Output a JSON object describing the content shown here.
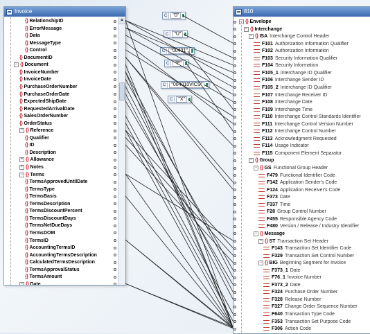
{
  "invoice_panel": {
    "title": "Invoice",
    "rows": [
      {
        "label": "RelationshipID",
        "level": 3,
        "kind": "elem"
      },
      {
        "label": "ErrorMessage",
        "level": 3,
        "kind": "elem"
      },
      {
        "label": "Data",
        "level": 3,
        "kind": "elem"
      },
      {
        "label": "MessageType",
        "level": 3,
        "kind": "elem"
      },
      {
        "label": "Control",
        "level": 3,
        "kind": "elem"
      },
      {
        "label": "DocumentID",
        "level": 2,
        "kind": "elem"
      },
      {
        "label": "Document",
        "level": 1,
        "kind": "group",
        "toggle": "−"
      },
      {
        "label": "InvoiceNumber",
        "level": 2,
        "kind": "elem"
      },
      {
        "label": "InvoiceDate",
        "level": 2,
        "kind": "elem"
      },
      {
        "label": "PurchaseOrderNumber",
        "level": 2,
        "kind": "elem"
      },
      {
        "label": "PurchaseOrderDate",
        "level": 2,
        "kind": "elem"
      },
      {
        "label": "ExpectedShipDate",
        "level": 2,
        "kind": "elem"
      },
      {
        "label": "RequestedArrivalDate",
        "level": 2,
        "kind": "elem"
      },
      {
        "label": "SalesOrderNumber",
        "level": 2,
        "kind": "elem"
      },
      {
        "label": "OrderStatus",
        "level": 2,
        "kind": "elem"
      },
      {
        "label": "Reference",
        "level": 2,
        "kind": "group",
        "toggle": "−"
      },
      {
        "label": "Qualifier",
        "level": 3,
        "kind": "elem"
      },
      {
        "label": "ID",
        "level": 3,
        "kind": "elem"
      },
      {
        "label": "Description",
        "level": 3,
        "kind": "elem"
      },
      {
        "label": "Allowance",
        "level": 2,
        "kind": "group",
        "toggle": "+"
      },
      {
        "label": "Notes",
        "level": 2,
        "kind": "group",
        "toggle": "+"
      },
      {
        "label": "Terms",
        "level": 2,
        "kind": "group",
        "toggle": "−"
      },
      {
        "label": "TermsApprovedUntilDate",
        "level": 3,
        "kind": "elem"
      },
      {
        "label": "TermsType",
        "level": 3,
        "kind": "elem"
      },
      {
        "label": "TermsBasis",
        "level": 3,
        "kind": "elem"
      },
      {
        "label": "TermsDescription",
        "level": 3,
        "kind": "elem"
      },
      {
        "label": "TermsDiscountPercent",
        "level": 3,
        "kind": "elem"
      },
      {
        "label": "TermsDiscountDays",
        "level": 3,
        "kind": "elem"
      },
      {
        "label": "TermsNetDueDays",
        "level": 3,
        "kind": "elem"
      },
      {
        "label": "TermsDOM",
        "level": 3,
        "kind": "elem"
      },
      {
        "label": "TermsID",
        "level": 3,
        "kind": "elem"
      },
      {
        "label": "AccountingTermsID",
        "level": 3,
        "kind": "elem"
      },
      {
        "label": "AccountingTermsDescription",
        "level": 3,
        "kind": "elem"
      },
      {
        "label": "CalculatedTermsDescription",
        "level": 3,
        "kind": "elem"
      },
      {
        "label": "TermsApprovalStatus",
        "level": 3,
        "kind": "elem"
      },
      {
        "label": "TermsAmount",
        "level": 3,
        "kind": "elem"
      },
      {
        "label": "Date",
        "level": 2,
        "kind": "group",
        "toggle": "−"
      }
    ]
  },
  "edi_panel": {
    "title": "810",
    "rows": [
      {
        "label": "Envelope",
        "level": 0,
        "kind": "group",
        "toggle": "−"
      },
      {
        "label": "Interchange",
        "level": 1,
        "kind": "group",
        "toggle": "−"
      },
      {
        "label": "ISA",
        "desc": "Interchange Control Header",
        "level": 2,
        "kind": "group",
        "toggle": "−"
      },
      {
        "label": "F101",
        "desc": "Authorization Information Qualifier",
        "level": 3,
        "kind": "attr"
      },
      {
        "label": "F102",
        "desc": "Authorization Information",
        "level": 3,
        "kind": "attr"
      },
      {
        "label": "F103",
        "desc": "Security Information Qualifier",
        "level": 3,
        "kind": "attr"
      },
      {
        "label": "F104",
        "desc": "Security Information",
        "level": 3,
        "kind": "attr"
      },
      {
        "label": "F105_1",
        "desc": "Interchange ID Qualifier",
        "level": 3,
        "kind": "attr"
      },
      {
        "label": "F106",
        "desc": "Interchange Sender ID",
        "level": 3,
        "kind": "attr"
      },
      {
        "label": "F105_2",
        "desc": "Interchange ID Qualifier",
        "level": 3,
        "kind": "attr"
      },
      {
        "label": "F107",
        "desc": "Interchange Receiver ID",
        "level": 3,
        "kind": "attr"
      },
      {
        "label": "F108",
        "desc": "Interchange Date",
        "level": 3,
        "kind": "attr"
      },
      {
        "label": "F109",
        "desc": "Interchange Time",
        "level": 3,
        "kind": "attr"
      },
      {
        "label": "F110",
        "desc": "Interchange Control Standards Identifier",
        "level": 3,
        "kind": "attr"
      },
      {
        "label": "F111",
        "desc": "Interchange Control Version Number",
        "level": 3,
        "kind": "attr"
      },
      {
        "label": "F112",
        "desc": "Interchange Control Number",
        "level": 3,
        "kind": "attr"
      },
      {
        "label": "F113",
        "desc": "Acknowledgment Requested",
        "level": 3,
        "kind": "attr"
      },
      {
        "label": "F114",
        "desc": "Usage Indicator",
        "level": 3,
        "kind": "attr"
      },
      {
        "label": "F115",
        "desc": "Component Element Separator",
        "level": 3,
        "kind": "attr"
      },
      {
        "label": "Group",
        "level": 2,
        "kind": "group",
        "toggle": "−"
      },
      {
        "label": "GS",
        "desc": "Functional Group Header",
        "level": 3,
        "kind": "group",
        "toggle": "−"
      },
      {
        "label": "F479",
        "desc": "Functional Identifier Code",
        "level": 4,
        "kind": "attr"
      },
      {
        "label": "F142",
        "desc": "Application Sender's Code",
        "level": 4,
        "kind": "attr"
      },
      {
        "label": "F124",
        "desc": "Application Receiver's Code",
        "level": 4,
        "kind": "attr"
      },
      {
        "label": "F373",
        "desc": "Date",
        "level": 4,
        "kind": "attr"
      },
      {
        "label": "F337",
        "desc": "Time",
        "level": 4,
        "kind": "attr"
      },
      {
        "label": "F28",
        "desc": "Group Control Number",
        "level": 4,
        "kind": "attr"
      },
      {
        "label": "F455",
        "desc": "Responsible Agency Code",
        "level": 4,
        "kind": "attr"
      },
      {
        "label": "F480",
        "desc": "Version / Release / Industry Identifier",
        "level": 4,
        "kind": "attr"
      },
      {
        "label": "Message",
        "level": 3,
        "kind": "group",
        "toggle": "−"
      },
      {
        "label": "ST",
        "desc": "Transaction Set Header",
        "level": 4,
        "kind": "group",
        "toggle": "−"
      },
      {
        "label": "F143",
        "desc": "Transaction Set Identifier Code",
        "level": 5,
        "kind": "attr"
      },
      {
        "label": "F329",
        "desc": "Transaction Set Control Number",
        "level": 5,
        "kind": "attr"
      },
      {
        "label": "BIG",
        "desc": "Beginning Segment for Invoice",
        "level": 4,
        "kind": "group",
        "toggle": "−"
      },
      {
        "label": "F373_1",
        "desc": "Date",
        "level": 5,
        "kind": "attr"
      },
      {
        "label": "F76_1",
        "desc": "Invoice Number",
        "level": 5,
        "kind": "attr"
      },
      {
        "label": "F373_2",
        "desc": "Date",
        "level": 5,
        "kind": "attr"
      },
      {
        "label": "F324",
        "desc": "Purchase Order Number",
        "level": 5,
        "kind": "attr"
      },
      {
        "label": "F328",
        "desc": "Release Number",
        "level": 5,
        "kind": "attr"
      },
      {
        "label": "F327",
        "desc": "Change Order Sequence Number",
        "level": 5,
        "kind": "attr"
      },
      {
        "label": "F640",
        "desc": "Transaction Type Code",
        "level": 5,
        "kind": "attr"
      },
      {
        "label": "F353",
        "desc": "Transaction Set Purpose Code",
        "level": 5,
        "kind": "attr"
      },
      {
        "label": "F306",
        "desc": "Action Code",
        "level": 5,
        "kind": "attr"
      }
    ]
  },
  "constants": [
    {
      "label": "C",
      "value": "\"0\""
    },
    {
      "label": "C",
      "value": "\"U\""
    },
    {
      "label": "C",
      "value": "\"00401\""
    },
    {
      "label": "C",
      "value": "\"P\""
    },
    {
      "label": "C",
      "value": "\"004010VICS\""
    },
    {
      "label": "C",
      "value": "\"X\""
    }
  ],
  "icons": {
    "element": "element-icon",
    "attribute": "attribute-icon",
    "panel": "component-icon"
  },
  "colors": {
    "element_brace": "#cc2233",
    "attribute": "#c0392b",
    "titlebar": "#3a6ab0",
    "wire": "#222222",
    "port_green": "#2b8a6a"
  }
}
